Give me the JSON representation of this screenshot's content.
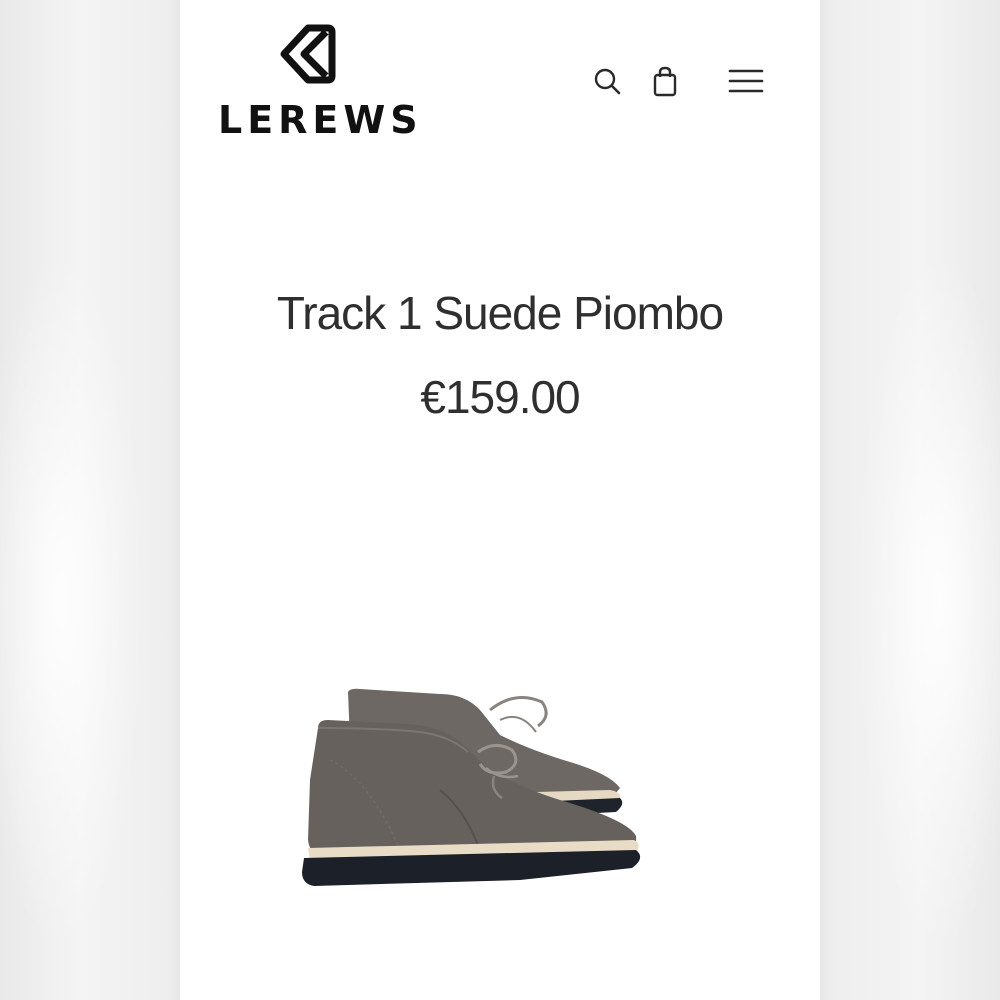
{
  "brand": {
    "name": "LEREWS",
    "logo_icon": "chevron-double-left-icon"
  },
  "header": {
    "icons": [
      "search-icon",
      "shopping-bag-icon",
      "hamburger-menu-icon"
    ]
  },
  "product": {
    "title": "Track 1 Suede Piombo",
    "price": "€159.00",
    "image_subject": "grey suede desert boots"
  },
  "colors": {
    "text": "#2f2f2f",
    "logo": "#111111",
    "background": "#ffffff",
    "boot_suede": "#6b6561",
    "boot_sole": "#1c2028",
    "boot_midsole": "#e9dcc6"
  }
}
